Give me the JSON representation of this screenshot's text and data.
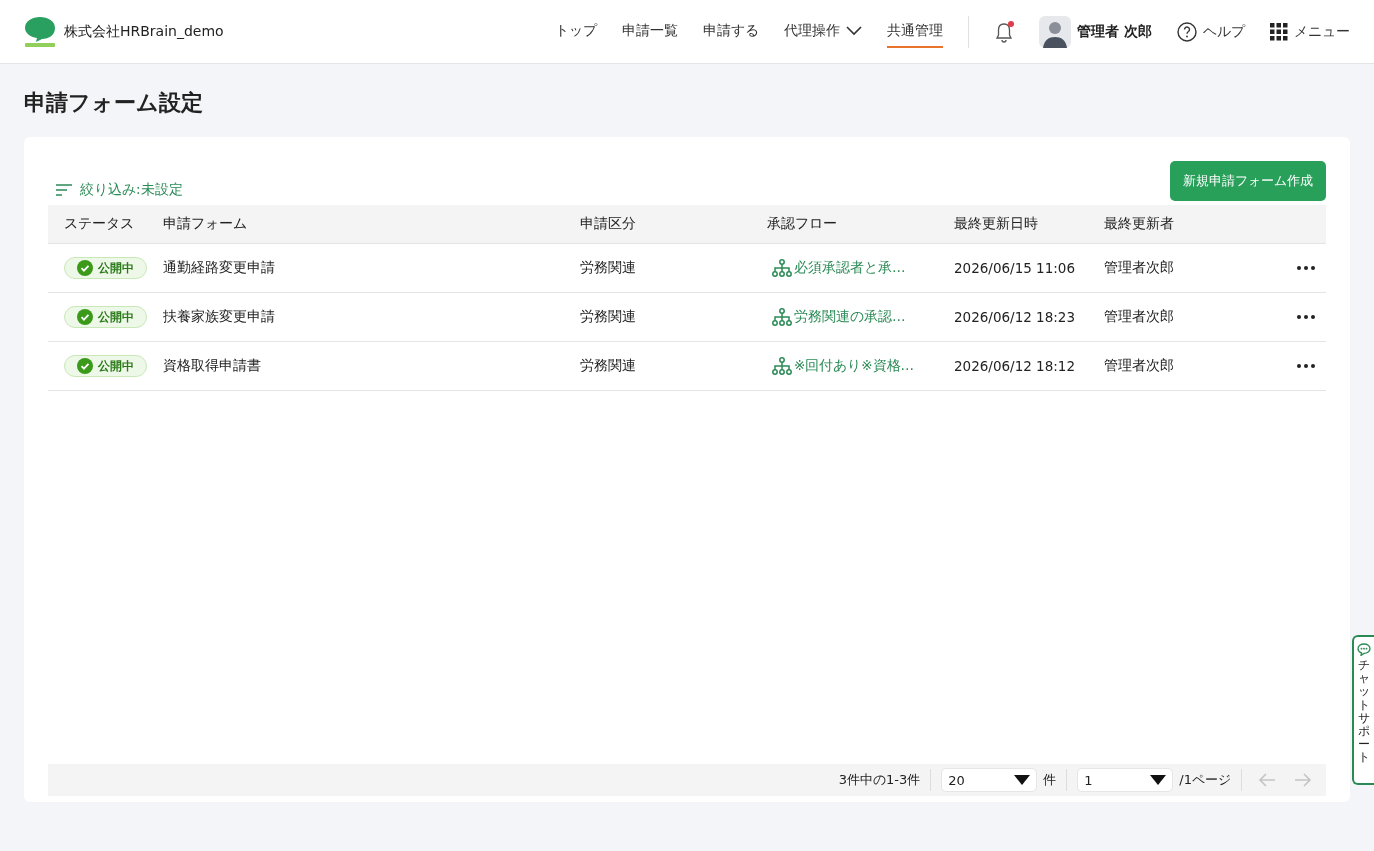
{
  "header": {
    "company": "株式会社HRBrain_demo",
    "nav": [
      {
        "label": "トップ",
        "selected": false,
        "has_menu": false
      },
      {
        "label": "申請一覧",
        "selected": false,
        "has_menu": false
      },
      {
        "label": "申請する",
        "selected": false,
        "has_menu": false
      },
      {
        "label": "代理操作",
        "selected": false,
        "has_menu": true
      },
      {
        "label": "共通管理",
        "selected": true,
        "has_menu": false
      }
    ],
    "notification": {
      "unread": true
    },
    "user": "管理者 次郎",
    "help": "ヘルプ",
    "menu": "メニュー"
  },
  "page_title": "申請フォーム設定",
  "filter": "絞り込み:未設定",
  "create_button": "新規申請フォーム作成",
  "table": {
    "columns": [
      "ステータス",
      "申請フォーム",
      "申請区分",
      "承認フロー",
      "最終更新日時",
      "最終更新者"
    ],
    "rows": [
      {
        "status": "公開中",
        "form": "通勤経路変更申請",
        "category": "労務関連",
        "flow": "必須承認者と承…",
        "updated": "2026/06/15 11:06",
        "updater": "管理者次郎"
      },
      {
        "status": "公開中",
        "form": "扶養家族変更申請",
        "category": "労務関連",
        "flow": "労務関連の承認…",
        "updated": "2026/06/12 18:23",
        "updater": "管理者次郎"
      },
      {
        "status": "公開中",
        "form": "資格取得申請書",
        "category": "労務関連",
        "flow": "※回付あり※資格…",
        "updated": "2026/06/12 18:12",
        "updater": "管理者次郎"
      }
    ]
  },
  "pagination": {
    "summary": "3件中の1-3件",
    "per_page": "20",
    "per_page_unit": "件",
    "page": "1",
    "page_total": "/1ページ",
    "prev_disabled": true,
    "next_disabled": true
  },
  "chat_support": "チャットサポート"
}
